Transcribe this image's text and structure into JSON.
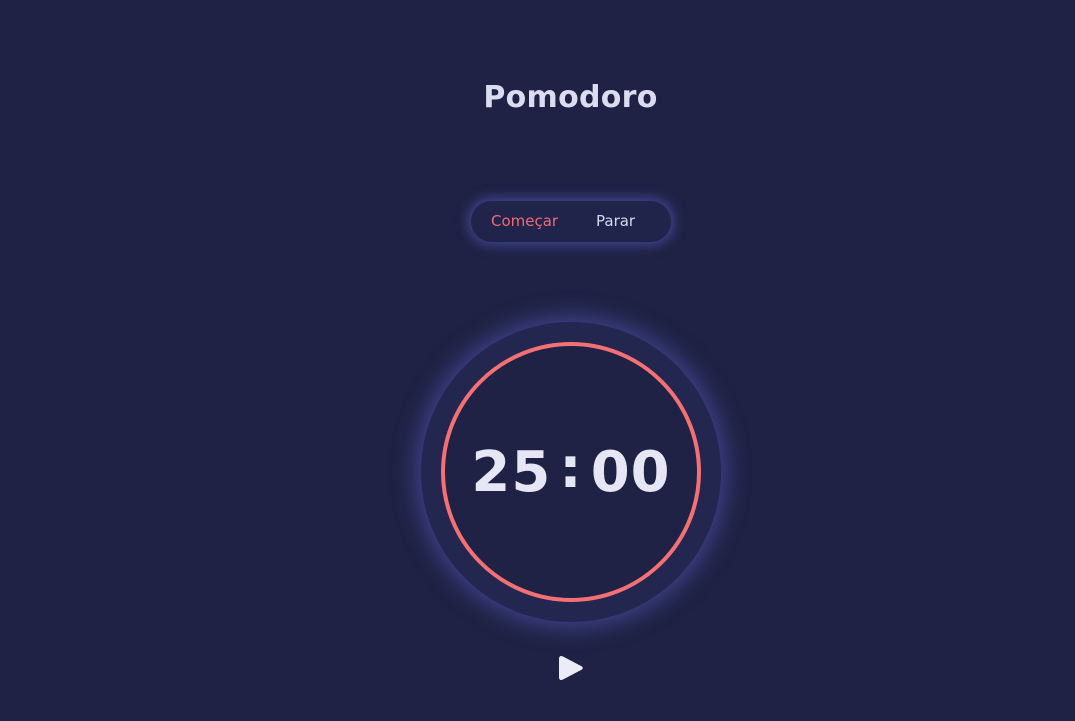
{
  "header": {
    "title": "Pomodoro"
  },
  "mode_switch": {
    "start_label": "Começar",
    "stop_label": "Parar",
    "active": "start"
  },
  "timer": {
    "minutes": "25",
    "separator": ":",
    "seconds": "00",
    "progress": 1.0
  },
  "controls": {
    "play_icon": "play-icon"
  },
  "colors": {
    "background": "#1f2244",
    "accent": "#f37074",
    "glow": "#6065d2",
    "text": "#e6e6f4"
  }
}
